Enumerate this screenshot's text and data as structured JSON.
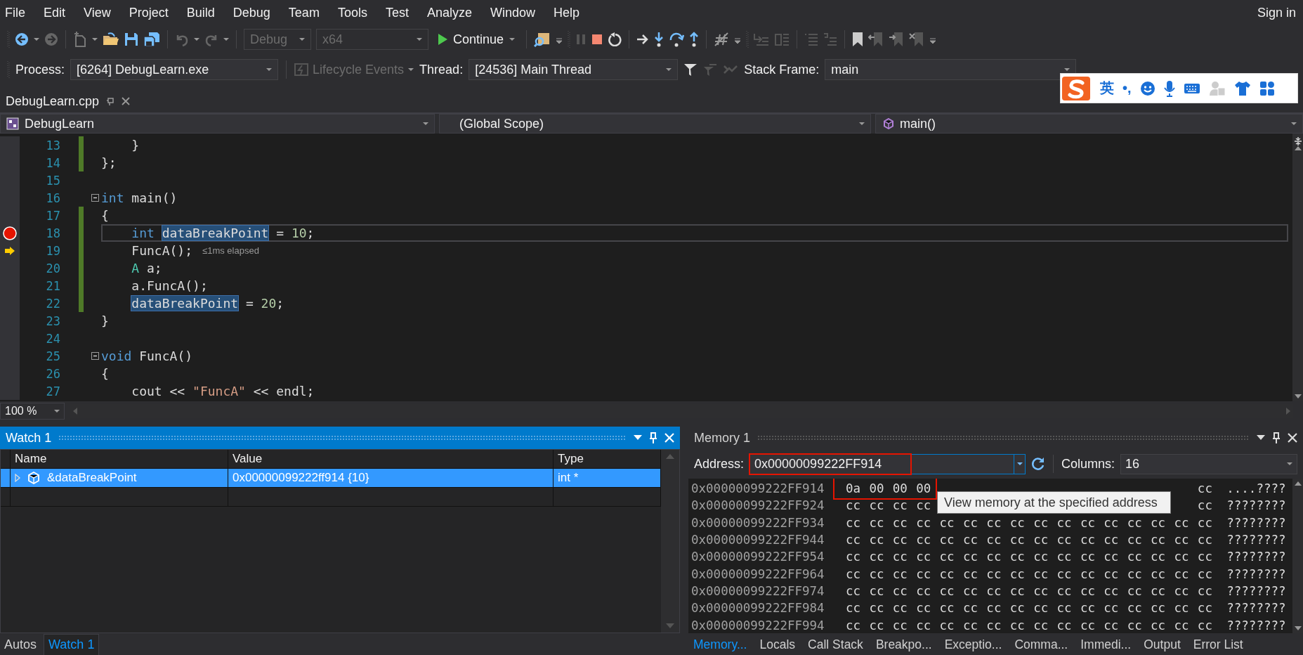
{
  "menu": [
    "File",
    "Edit",
    "View",
    "Project",
    "Build",
    "Debug",
    "Team",
    "Tools",
    "Test",
    "Analyze",
    "Window",
    "Help"
  ],
  "sign_in": "Sign in",
  "toolbar": {
    "configuration": {
      "value": "Debug",
      "disabled": true
    },
    "platform": {
      "value": "x64",
      "disabled": true
    },
    "continue": "Continue"
  },
  "debug_location": {
    "process_label": "Process:",
    "process": "[6264] DebugLearn.exe",
    "lifecycle": {
      "label": "Lifecycle Events",
      "disabled": true
    },
    "thread_label": "Thread:",
    "thread": "[24536] Main Thread",
    "stack_label": "Stack Frame:",
    "stack_frame": "main"
  },
  "ime_bar": {
    "mode": "英",
    "punctuation": "•,"
  },
  "document_tab": {
    "title": "DebugLearn.cpp"
  },
  "navigation": {
    "project": "DebugLearn",
    "scope": "(Global Scope)",
    "member": "main()"
  },
  "editor": {
    "lines": [
      {
        "number": "13",
        "changed": true,
        "indented": true,
        "tokens": [
          {
            "kind": "plain",
            "text": "}"
          }
        ]
      },
      {
        "number": "14",
        "changed": true,
        "indented": false,
        "tokens": [
          {
            "kind": "plain",
            "text": "};"
          }
        ]
      },
      {
        "number": "15",
        "changed": false,
        "indented": false
      },
      {
        "number": "16",
        "changed": false,
        "indented": false,
        "fold": true,
        "tokens": [
          {
            "kind": "keyword",
            "text": "int"
          },
          {
            "kind": "plain",
            "text": " main()"
          }
        ]
      },
      {
        "number": "17",
        "changed": true,
        "indented": false,
        "tokens": [
          {
            "kind": "plain",
            "text": "{"
          }
        ]
      },
      {
        "number": "18",
        "changed": true,
        "indented": true,
        "breakpoint": true,
        "caret_line": true,
        "tokens": [
          {
            "kind": "keyword",
            "text": "int"
          },
          {
            "kind": "ref",
            "text": "dataBreakPoint"
          },
          {
            "kind": "plain",
            "text": " = "
          },
          {
            "kind": "number",
            "text": "10"
          },
          {
            "kind": "plain",
            "text": ";"
          }
        ]
      },
      {
        "number": "19",
        "changed": true,
        "indented": true,
        "next_statement": true,
        "tokens": [
          {
            "kind": "plain",
            "text": "FuncA();"
          },
          {
            "kind": "hint",
            "text": "≤1ms elapsed"
          }
        ]
      },
      {
        "number": "20",
        "changed": true,
        "indented": true,
        "tokens": [
          {
            "kind": "type",
            "text": "A"
          },
          {
            "kind": "plain",
            "text": " a;"
          }
        ]
      },
      {
        "number": "21",
        "changed": true,
        "indented": true,
        "tokens": [
          {
            "kind": "plain",
            "text": "a.FuncA();"
          }
        ]
      },
      {
        "number": "22",
        "changed": true,
        "indented": true,
        "tokens": [
          {
            "kind": "ref",
            "text": "dataBreakPoint"
          },
          {
            "kind": "plain",
            "text": " = "
          },
          {
            "kind": "number",
            "text": "20"
          },
          {
            "kind": "plain",
            "text": ";"
          }
        ]
      },
      {
        "number": "23",
        "changed": false,
        "indented": false,
        "tokens": [
          {
            "kind": "plain",
            "text": "}"
          }
        ]
      },
      {
        "number": "24",
        "changed": false,
        "indented": false
      },
      {
        "number": "25",
        "changed": false,
        "indented": false,
        "fold": true,
        "tokens": [
          {
            "kind": "keyword",
            "text": "void"
          },
          {
            "kind": "plain",
            "text": " FuncA()"
          }
        ]
      },
      {
        "number": "26",
        "changed": false,
        "indented": false,
        "tokens": [
          {
            "kind": "plain",
            "text": "{"
          }
        ]
      },
      {
        "number": "27",
        "changed": false,
        "indented": true,
        "tokens": [
          {
            "kind": "plain",
            "text": "cout << "
          },
          {
            "kind": "string",
            "text": "\"FuncA\""
          },
          {
            "kind": "plain",
            "text": " << endl;"
          }
        ]
      }
    ]
  },
  "zoom": "100 %",
  "watch": {
    "title": "Watch 1",
    "columns": [
      "Name",
      "Value",
      "Type"
    ],
    "rows": [
      {
        "name": "&dataBreakPoint",
        "value": "0x00000099222ff914 {10}",
        "type": "int *",
        "selected": true,
        "expanded": false
      }
    ]
  },
  "memory": {
    "title": "Memory 1",
    "address_label": "Address:",
    "address": {
      "value": "0x00000099222FF914",
      "marked": true
    },
    "columns_label": "Columns:",
    "columns": "16",
    "tooltip": "View memory at the specified address",
    "rows": [
      {
        "address": "0x00000099222FF914",
        "marked": true,
        "bytes": [
          "0a",
          "00",
          "00",
          "00"
        ],
        "end_byte": "cc",
        "text": "....????"
      },
      {
        "address": "0x00000099222FF924",
        "marked": false,
        "bytes": [
          "cc",
          "cc",
          "cc",
          "cc"
        ],
        "end_byte": "cc",
        "text": "????????"
      },
      {
        "address": "0x00000099222FF934",
        "marked": false,
        "bytes": [
          "cc",
          "cc",
          "cc",
          "cc",
          "cc",
          "cc",
          "cc",
          "cc",
          "cc",
          "cc",
          "cc",
          "cc",
          "cc",
          "cc",
          "cc",
          "cc"
        ],
        "text": "????????"
      },
      {
        "address": "0x00000099222FF944",
        "marked": false,
        "bytes": [
          "cc",
          "cc",
          "cc",
          "cc",
          "cc",
          "cc",
          "cc",
          "cc",
          "cc",
          "cc",
          "cc",
          "cc",
          "cc",
          "cc",
          "cc",
          "cc"
        ],
        "text": "????????"
      },
      {
        "address": "0x00000099222FF954",
        "marked": false,
        "bytes": [
          "cc",
          "cc",
          "cc",
          "cc",
          "cc",
          "cc",
          "cc",
          "cc",
          "cc",
          "cc",
          "cc",
          "cc",
          "cc",
          "cc",
          "cc",
          "cc"
        ],
        "text": "????????"
      },
      {
        "address": "0x00000099222FF964",
        "marked": false,
        "bytes": [
          "cc",
          "cc",
          "cc",
          "cc",
          "cc",
          "cc",
          "cc",
          "cc",
          "cc",
          "cc",
          "cc",
          "cc",
          "cc",
          "cc",
          "cc",
          "cc"
        ],
        "text": "????????"
      },
      {
        "address": "0x00000099222FF974",
        "marked": false,
        "bytes": [
          "cc",
          "cc",
          "cc",
          "cc",
          "cc",
          "cc",
          "cc",
          "cc",
          "cc",
          "cc",
          "cc",
          "cc",
          "cc",
          "cc",
          "cc",
          "cc"
        ],
        "text": "????????"
      },
      {
        "address": "0x00000099222FF984",
        "marked": false,
        "bytes": [
          "cc",
          "cc",
          "cc",
          "cc",
          "cc",
          "cc",
          "cc",
          "cc",
          "cc",
          "cc",
          "cc",
          "cc",
          "cc",
          "cc",
          "cc",
          "cc"
        ],
        "text": "????????"
      },
      {
        "address": "0x00000099222FF994",
        "marked": false,
        "bytes": [
          "cc",
          "cc",
          "cc",
          "cc",
          "cc",
          "cc",
          "cc",
          "cc",
          "cc",
          "cc",
          "cc",
          "cc",
          "cc",
          "cc",
          "cc",
          "cc"
        ],
        "text": "????????"
      }
    ]
  },
  "left_tabs": [
    {
      "label": "Autos",
      "selected": false
    },
    {
      "label": "Watch 1",
      "selected": true
    }
  ],
  "right_tabs": [
    {
      "label": "Memory...",
      "selected": true
    },
    {
      "label": "Locals",
      "selected": false
    },
    {
      "label": "Call Stack",
      "selected": false
    },
    {
      "label": "Breakpo...",
      "selected": false
    },
    {
      "label": "Exceptio...",
      "selected": false
    },
    {
      "label": "Comma...",
      "selected": false
    },
    {
      "label": "Immedi...",
      "selected": false
    },
    {
      "label": "Output",
      "selected": false
    },
    {
      "label": "Error List",
      "selected": false
    }
  ]
}
